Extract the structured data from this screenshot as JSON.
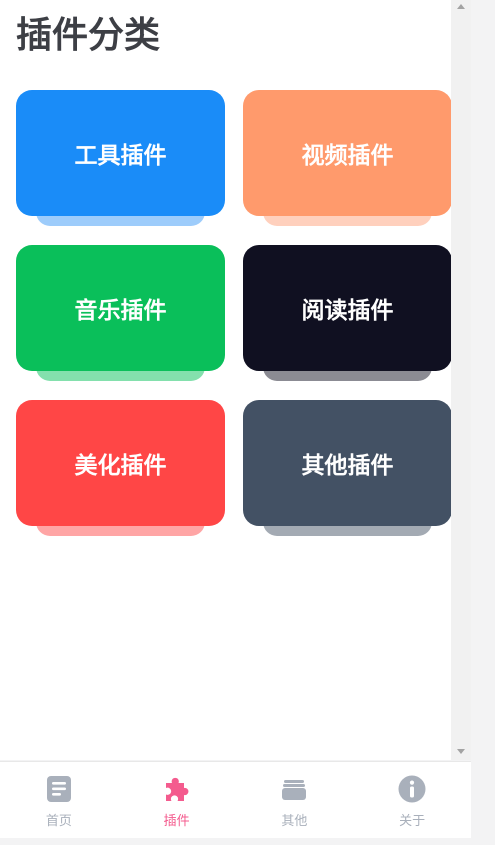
{
  "page": {
    "title": "插件分类"
  },
  "categories": [
    {
      "label": "工具插件",
      "color": "#1a8cf8",
      "shadow": "#9dccfb"
    },
    {
      "label": "视频插件",
      "color": "#ff9a6c",
      "shadow": "#ffd0bd"
    },
    {
      "label": "音乐插件",
      "color": "#0abf5a",
      "shadow": "#84e0ad"
    },
    {
      "label": "阅读插件",
      "color": "#101021",
      "shadow": "#8b8b93"
    },
    {
      "label": "美化插件",
      "color": "#ff4646",
      "shadow": "#ffa5a5"
    },
    {
      "label": "其他插件",
      "color": "#435164",
      "shadow": "#a3aab3"
    }
  ],
  "tabbar": {
    "items": [
      {
        "label": "首页",
        "icon": "document-icon",
        "active": false
      },
      {
        "label": "插件",
        "icon": "puzzle-icon",
        "active": true
      },
      {
        "label": "其他",
        "icon": "folder-icon",
        "active": false
      },
      {
        "label": "关于",
        "icon": "info-icon",
        "active": false
      }
    ],
    "active_color": "#f45b8e",
    "inactive_color": "#a9b0bb"
  }
}
